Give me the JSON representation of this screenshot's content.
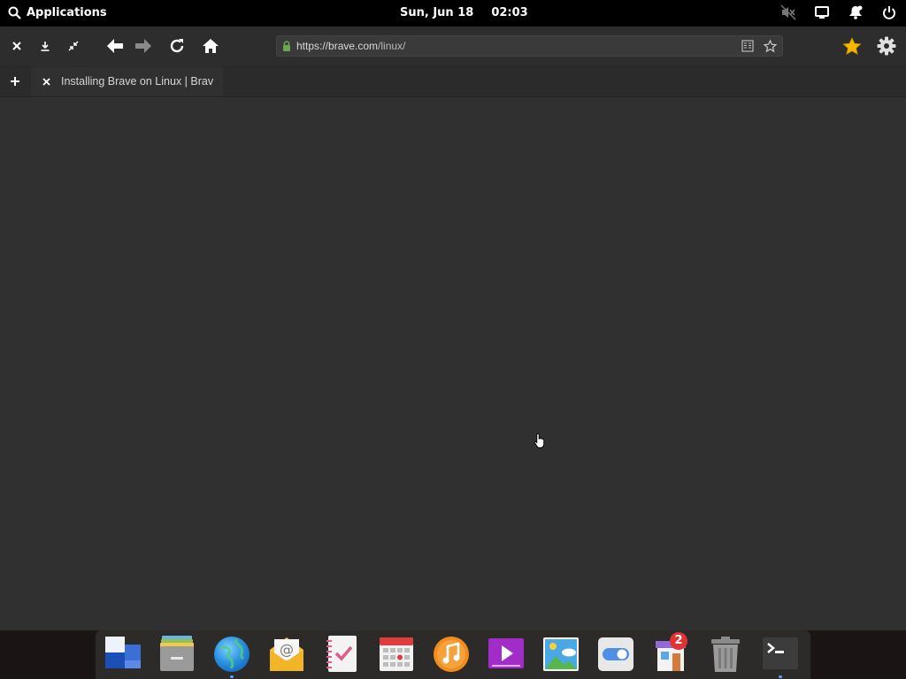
{
  "topbar": {
    "applications_label": "Applications",
    "date": "Sun, Jun 18",
    "time": "02:03"
  },
  "toolbar": {
    "url_host": "https://brave.com",
    "url_path": "/linux/"
  },
  "tabs": [
    {
      "title": "Installing Brave on Linux | Brave"
    }
  ],
  "dock": {
    "items": [
      "multitasking-view",
      "files",
      "web-browser",
      "mail",
      "tasks",
      "calendar",
      "music",
      "videos",
      "photos",
      "system-settings",
      "appcenter",
      "trash",
      "terminal"
    ],
    "appcenter_badge": "2"
  },
  "colors": {
    "accent_star": "#f5b800",
    "lock": "#6aa84f",
    "dock_running": "#58a0ff"
  }
}
